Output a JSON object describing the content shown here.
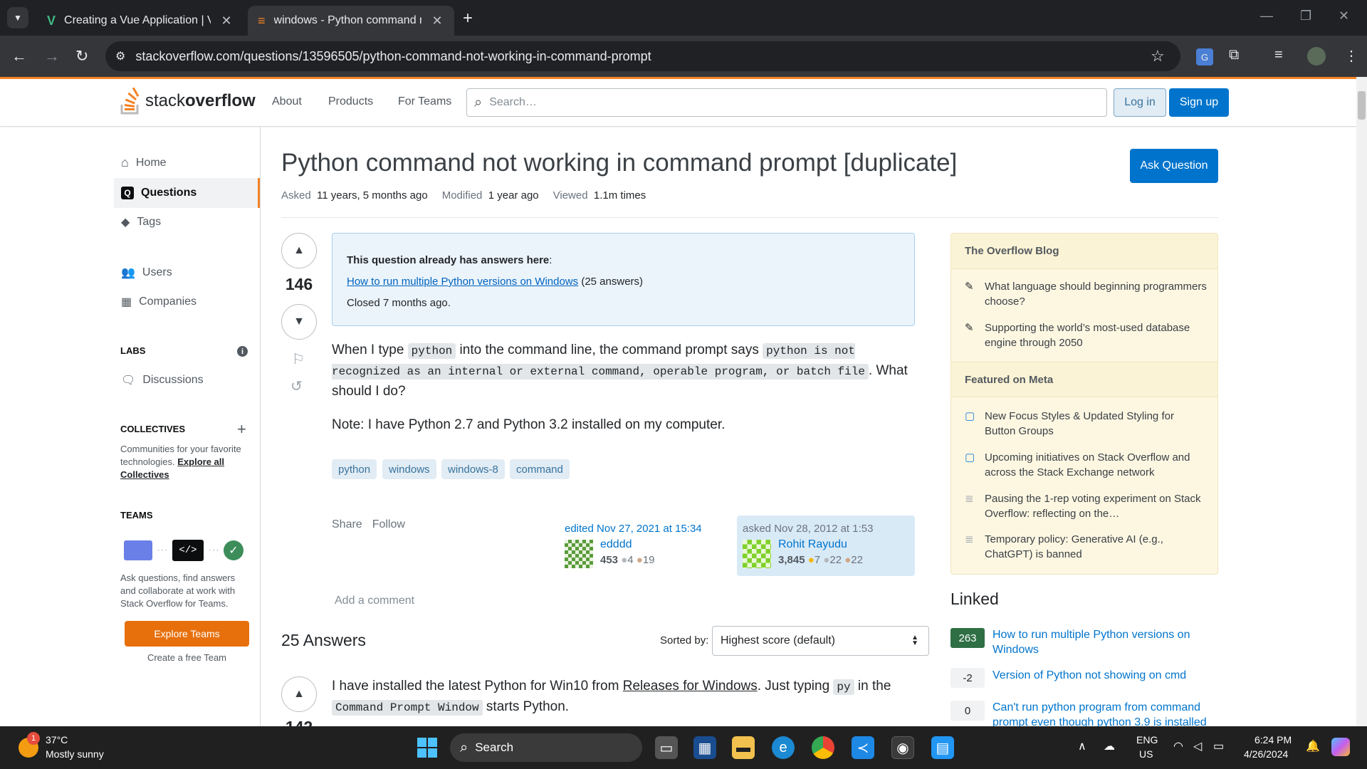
{
  "browser": {
    "tabs": [
      {
        "title": "Creating a Vue Application | Vue.js",
        "active": false
      },
      {
        "title": "windows - Python command not working in command prompt",
        "active": true
      }
    ],
    "url": "stackoverflow.com/questions/13596505/python-command-not-working-in-command-prompt"
  },
  "header": {
    "logo_text_light": "stack",
    "logo_text_bold": "overflow",
    "nav": [
      "About",
      "Products",
      "For Teams"
    ],
    "search_placeholder": "Search…",
    "login_label": "Log in",
    "signup_label": "Sign up"
  },
  "left_nav": {
    "home": "Home",
    "questions": "Questions",
    "tags": "Tags",
    "users": "Users",
    "companies": "Companies",
    "labs_heading": "LABS",
    "discussions": "Discussions",
    "collectives_heading": "COLLECTIVES",
    "collectives_text": "Communities for your favorite technologies.",
    "collectives_link": "Explore all Collectives",
    "teams_heading": "TEAMS",
    "teams_text": "Ask questions, find answers and collaborate at work with Stack Overflow for Teams.",
    "explore_teams": "Explore Teams",
    "create_team": "Create a free Team"
  },
  "question": {
    "title": "Python command not working in command prompt [duplicate]",
    "ask_button": "Ask Question",
    "asked_label": "Asked",
    "asked_value": "11 years, 5 months ago",
    "modified_label": "Modified",
    "modified_value": "1 year ago",
    "viewed_label": "Viewed",
    "viewed_value": "1.1m times",
    "votes": "146",
    "duplicate_heading": "This question already has answers here",
    "duplicate_link": "How to run multiple Python versions on Windows",
    "duplicate_answers": "(25 answers)",
    "closed_text": "Closed 7 months ago.",
    "body_p1_a": "When I type ",
    "body_p1_code1": "python",
    "body_p1_b": " into the command line, the command prompt says ",
    "body_p1_code2": "python is not recognized as an internal or external command, operable program, or batch file",
    "body_p1_c": ". What should I do?",
    "body_p2": "Note: I have Python 2.7 and Python 3.2 installed on my computer.",
    "tags": [
      "python",
      "windows",
      "windows-8",
      "command"
    ],
    "share": "Share",
    "follow": "Follow",
    "edited_action": "edited Nov 27, 2021 at 15:34",
    "editor_name": "edddd",
    "editor_rep": "453",
    "editor_silver": "4",
    "editor_bronze": "19",
    "asked_action": "asked Nov 28, 2012 at 1:53",
    "asker_name": "Rohit Rayudu",
    "asker_rep": "3,845",
    "asker_gold": "7",
    "asker_silver": "22",
    "asker_bronze": "22",
    "add_comment": "Add a comment"
  },
  "answers": {
    "count_label": "25 Answers",
    "sorted_by": "Sorted by:",
    "sort_value": "Highest score (default)",
    "first_answer_a": "I have installed the latest Python for Win10 from ",
    "first_answer_link": "Releases for Windows",
    "first_answer_b": ". Just typing ",
    "first_answer_code1": "py",
    "first_answer_c": " in the ",
    "first_answer_code2": "Command Prompt Window",
    "first_answer_d": " starts Python.",
    "first_answer_votes": "142"
  },
  "sidebar": {
    "blog_heading": "The Overflow Blog",
    "blog_items": [
      "What language should beginning programmers choose?",
      "Supporting the world’s most-used database engine through 2050"
    ],
    "meta_heading": "Featured on Meta",
    "meta_items": [
      "New Focus Styles & Updated Styling for Button Groups",
      "Upcoming initiatives on Stack Overflow and across the Stack Exchange network",
      "Pausing the 1-rep voting experiment on Stack Overflow: reflecting on the…",
      "Temporary policy: Generative AI (e.g., ChatGPT) is banned"
    ],
    "linked_heading": "Linked",
    "linked": [
      {
        "count": "263",
        "title": "How to run multiple Python versions on Windows",
        "accepted": true
      },
      {
        "count": "-2",
        "title": "Version of Python not showing on cmd",
        "accepted": false
      },
      {
        "count": "0",
        "title": "Can't run python program from command prompt even though python 3.9 is installed",
        "accepted": false
      }
    ]
  },
  "taskbar": {
    "weather_temp": "37°C",
    "weather_desc": "Mostly sunny",
    "weather_badge": "1",
    "search_label": "Search",
    "lang1": "ENG",
    "lang2": "US",
    "time": "6:24 PM",
    "date": "4/26/2024"
  },
  "colors": {
    "so_orange": "#f48225",
    "so_blue": "#0074cc",
    "accepted_green": "#2f6f44"
  }
}
